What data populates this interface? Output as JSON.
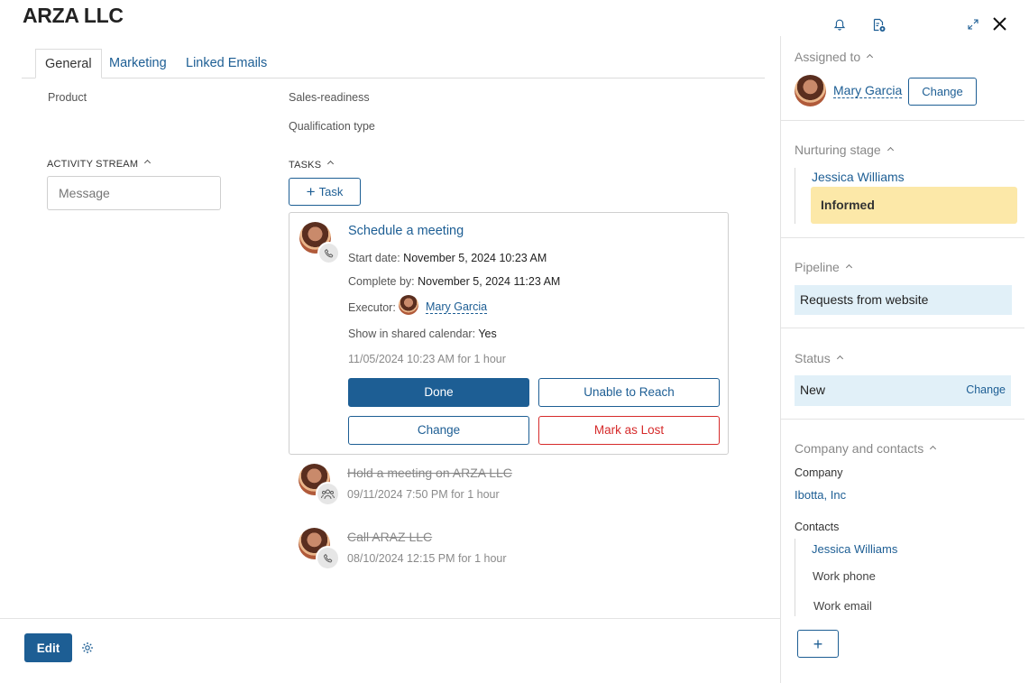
{
  "title": "ARZA LLC",
  "header_icons": [
    "bell-icon",
    "document-icon",
    "expand-icon",
    "close-icon"
  ],
  "tabs": [
    {
      "label": "General",
      "active": true
    },
    {
      "label": "Marketing",
      "active": false
    },
    {
      "label": "Linked Emails",
      "active": false
    }
  ],
  "fields": {
    "product": "Product",
    "sales_readiness": "Sales-readiness",
    "qualification_type": "Qualification type"
  },
  "activity_stream": {
    "heading": "ACTIVITY STREAM",
    "message_placeholder": "Message"
  },
  "tasks": {
    "heading": "TASKS",
    "add_label": "Task",
    "current": {
      "title": "Schedule a meeting",
      "start_label": "Start date:",
      "start_value": "November 5, 2024 10:23 AM",
      "complete_label": "Complete by:",
      "complete_value": "November 5, 2024 11:23 AM",
      "executor_label": "Executor:",
      "executor_value": "Mary Garcia",
      "calendar_label": "Show in shared calendar:",
      "calendar_value": "Yes",
      "time_summary": "11/05/2024 10:23 AM for 1 hour",
      "buttons": {
        "done": "Done",
        "unable": "Unable to Reach",
        "change": "Change",
        "lost": "Mark as Lost"
      }
    },
    "history": [
      {
        "title": "Hold a meeting on ARZA LLC",
        "time": "09/11/2024 7:50 PM for 1 hour",
        "icon": "people-icon"
      },
      {
        "title": "Call ARAZ LLC",
        "time": "08/10/2024 12:15 PM for 1 hour",
        "icon": "phone-icon"
      }
    ]
  },
  "footer": {
    "edit_label": "Edit"
  },
  "sidebar": {
    "assigned": {
      "heading": "Assigned to",
      "name": "Mary Garcia",
      "change_label": "Change"
    },
    "nurturing": {
      "heading": "Nurturing stage",
      "person": "Jessica Williams",
      "stage": "Informed",
      "stage_color": "#fce8a8"
    },
    "pipeline": {
      "heading": "Pipeline",
      "value": "Requests from website",
      "bg_color": "#e1f0f8"
    },
    "status": {
      "heading": "Status",
      "value": "New",
      "change_label": "Change"
    },
    "company": {
      "heading": "Company and contacts",
      "company_label": "Company",
      "company_value": "Ibotta, Inc",
      "contacts_label": "Contacts",
      "contact_name": "Jessica Williams",
      "work_phone": "Work phone",
      "work_email": "Work email",
      "add_label": "+"
    }
  }
}
